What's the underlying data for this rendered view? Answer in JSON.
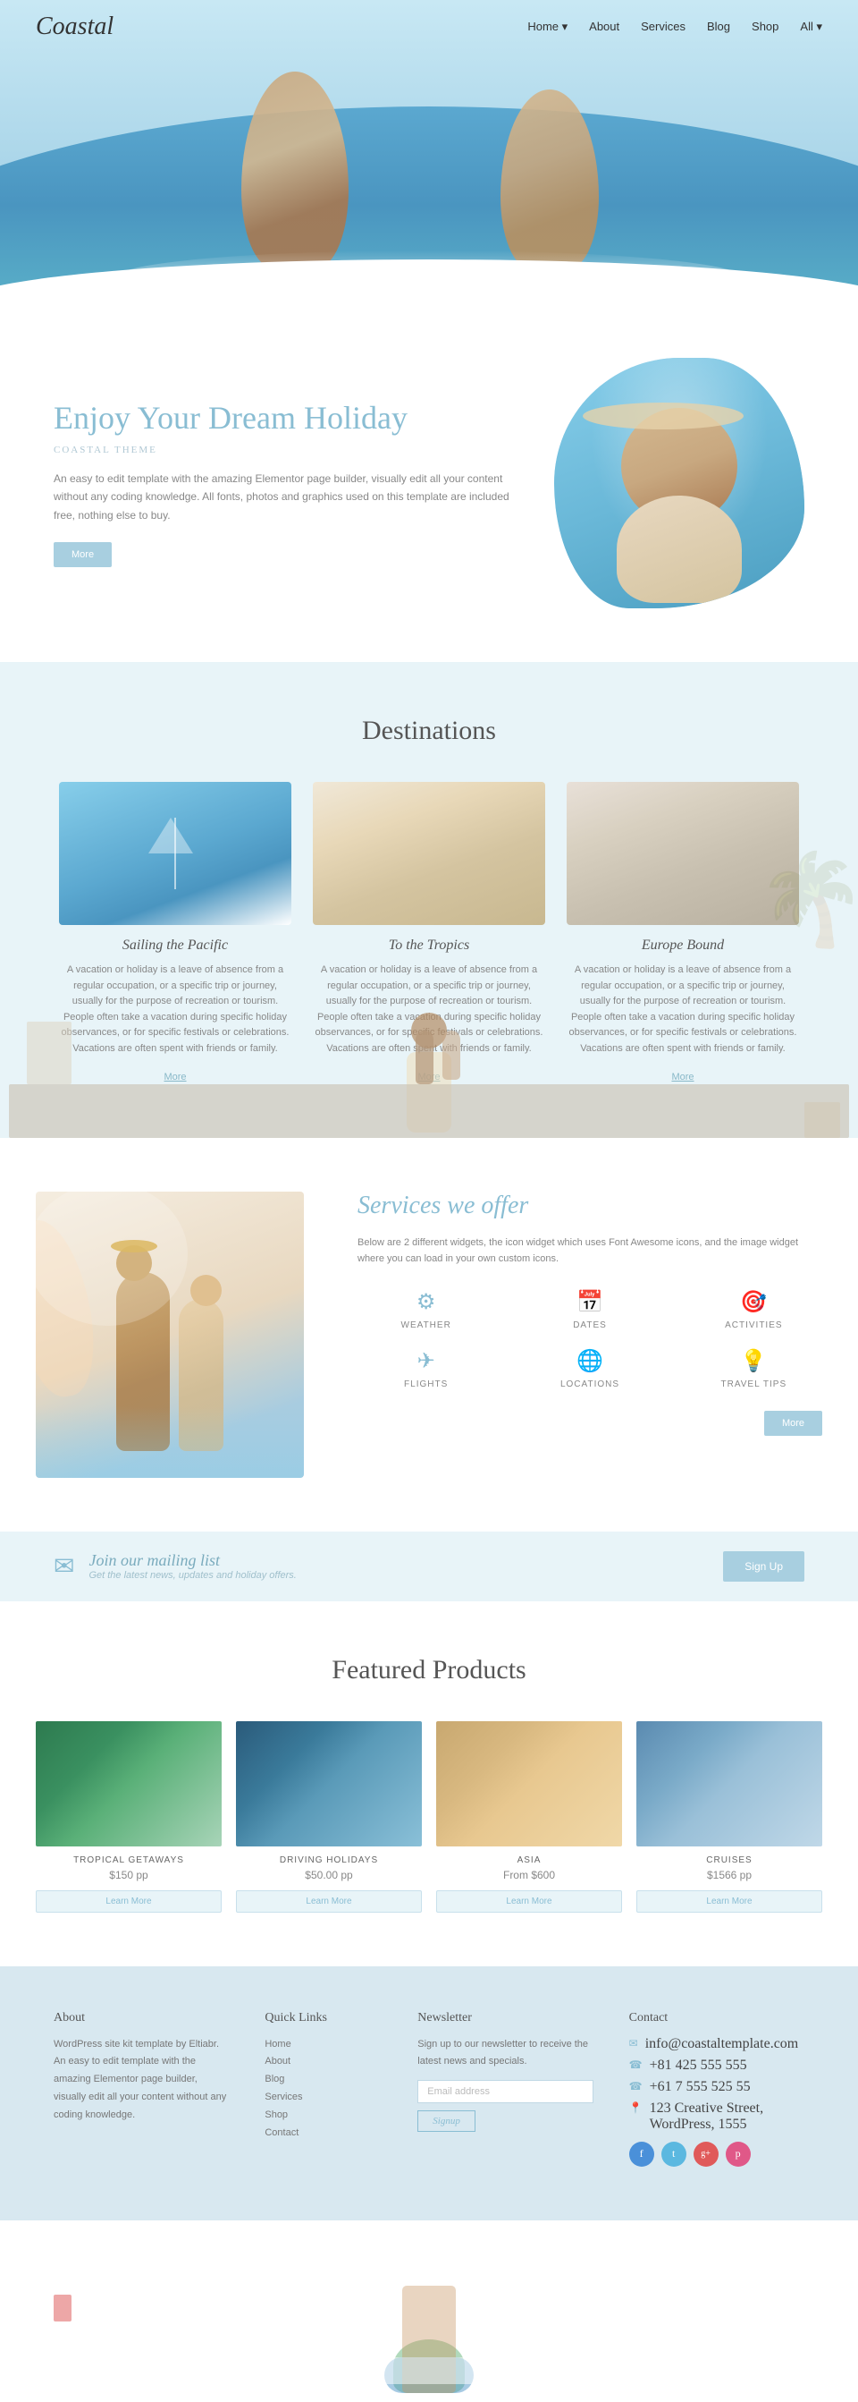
{
  "nav": {
    "logo": "Coastal",
    "links": [
      {
        "label": "Home",
        "has_dropdown": true
      },
      {
        "label": "About"
      },
      {
        "label": "Services"
      },
      {
        "label": "Blog"
      },
      {
        "label": "Shop"
      },
      {
        "label": "All",
        "has_dropdown": true
      }
    ]
  },
  "intro": {
    "title": "Enjoy Your Dream Holiday",
    "subtitle": "Coastal Theme",
    "description": "An easy to edit template with the amazing Elementor page builder, visually edit all your content without any coding knowledge. All fonts, photos and graphics used on this template are included free, nothing else to buy.",
    "more_btn": "More"
  },
  "destinations": {
    "section_title": "Destinations",
    "cards": [
      {
        "name": "Sailing the Pacific",
        "description": "A vacation or holiday is a leave of absence from a regular occupation, or a specific trip or journey, usually for the purpose of recreation or tourism. People often take a vacation during specific holiday observances, or for specific festivals or celebrations. Vacations are often spent with friends or family.",
        "more": "More"
      },
      {
        "name": "To the Tropics",
        "description": "A vacation or holiday is a leave of absence from a regular occupation, or a specific trip or journey, usually for the purpose of recreation or tourism. People often take a vacation during specific holiday observances, or for specific festivals or celebrations. Vacations are often spent with friends or family.",
        "more": "More"
      },
      {
        "name": "Europe Bound",
        "description": "A vacation or holiday is a leave of absence from a regular occupation, or a specific trip or journey, usually for the purpose of recreation or tourism. People often take a vacation during specific holiday observances, or for specific festivals or celebrations. Vacations are often spent with friends or family.",
        "more": "More"
      }
    ]
  },
  "services": {
    "section_title": "Services we offer",
    "description": "Below are 2 different widgets, the icon widget which uses Font Awesome icons, and the image widget where you can load in your own custom icons.",
    "items": [
      {
        "icon": "⚙",
        "label": "WEATHER"
      },
      {
        "icon": "📅",
        "label": "DATES"
      },
      {
        "icon": "🎯",
        "label": "ACTIVITIES"
      },
      {
        "icon": "✈",
        "label": "FLIGHTS"
      },
      {
        "icon": "🌐",
        "label": "LOCATIONS"
      },
      {
        "icon": "💡",
        "label": "TRAVEL TIPS"
      }
    ],
    "more_btn": "More"
  },
  "mailing": {
    "title": "Join our mailing list",
    "description": "Get the latest news, updates and holiday offers.",
    "signup_btn": "Sign Up"
  },
  "featured_products": {
    "section_title": "Featured Products",
    "products": [
      {
        "name": "TROPICAL GETAWAYS",
        "price": "$150 pp",
        "learn_btn": "Learn More",
        "img_class": "product-img-tropical"
      },
      {
        "name": "DRIVING HOLIDAYS",
        "price": "$50.00 pp",
        "learn_btn": "Learn More",
        "img_class": "product-img-driving"
      },
      {
        "name": "ASIA",
        "price": "From $600",
        "learn_btn": "Learn More",
        "img_class": "product-img-asia"
      },
      {
        "name": "CRUISES",
        "price": "$1566 pp",
        "learn_btn": "Learn More",
        "img_class": "product-img-cruises"
      }
    ]
  },
  "footer": {
    "about_title": "About",
    "about_text": "WordPress site kit template by Eltiabr. An easy to edit template with the amazing Elementor page builder, visually edit all your content without any coding knowledge.",
    "quicklinks_title": "Quick Links",
    "quicklinks": [
      "Home",
      "About",
      "Blog",
      "Services",
      "Shop",
      "Contact"
    ],
    "newsletter_title": "Newsletter",
    "newsletter_text": "Sign up to our newsletter to receive the latest news and specials.",
    "newsletter_placeholder": "",
    "newsletter_btn": "Signup",
    "contact_title": "Contact",
    "contact_email": "info@coastaltemplate.com",
    "contact_phone1": "+81 425 555 555",
    "contact_phone2": "+61 7 555 525 55",
    "contact_address": "123 Creative Street, WordPress, 1555",
    "social": [
      "f",
      "t",
      "g+",
      "p"
    ]
  }
}
